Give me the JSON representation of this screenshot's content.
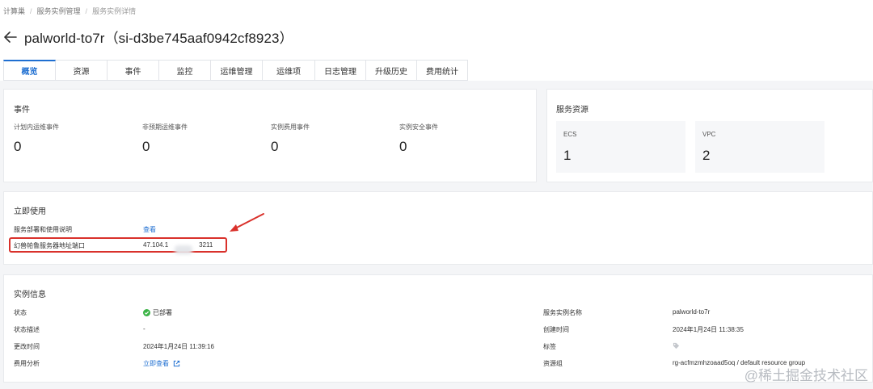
{
  "breadcrumb": {
    "items": [
      "计算巢",
      "服务实例管理",
      "服务实例详情"
    ]
  },
  "page": {
    "title": "palworld-to7r（si-d3be745aaf0942cf8923）"
  },
  "tabs": [
    "概览",
    "资源",
    "事件",
    "监控",
    "运维管理",
    "运维项",
    "日志管理",
    "升级历史",
    "费用统计"
  ],
  "events": {
    "title": "事件",
    "items": [
      {
        "label": "计划内运维事件",
        "value": "0"
      },
      {
        "label": "非预期运维事件",
        "value": "0"
      },
      {
        "label": "实例费用事件",
        "value": "0"
      },
      {
        "label": "实例安全事件",
        "value": "0"
      }
    ]
  },
  "resources": {
    "title": "服务资源",
    "items": [
      {
        "label": "ECS",
        "value": "1"
      },
      {
        "label": "VPC",
        "value": "2"
      }
    ]
  },
  "use_now": {
    "title": "立即使用",
    "rows": [
      {
        "label": "服务部署和使用说明",
        "value": "查看"
      },
      {
        "label": "幻兽帕鲁服务器地址端口",
        "value_prefix": "47.104.1",
        "value_suffix": "3211"
      }
    ]
  },
  "instance": {
    "title": "实例信息",
    "left": [
      {
        "label": "状态",
        "value": "已部署"
      },
      {
        "label": "状态描述",
        "value": "-"
      },
      {
        "label": "更改时间",
        "value": "2024年1月24日 11:39:16"
      },
      {
        "label": "费用分析",
        "value": "立即查看"
      }
    ],
    "right": [
      {
        "label": "服务实例名称",
        "value": "palworld-to7r"
      },
      {
        "label": "创建时间",
        "value": "2024年1月24日 11:38:35"
      },
      {
        "label": "标签",
        "value": ""
      },
      {
        "label": "资源组",
        "value": "rg-acfmzmhzoaad5oq / default resource group"
      }
    ]
  },
  "colors": {
    "accent": "#1f6fd1",
    "success": "#3bb346",
    "annotation": "#d9312b"
  },
  "watermark": "@稀土掘金技术社区"
}
